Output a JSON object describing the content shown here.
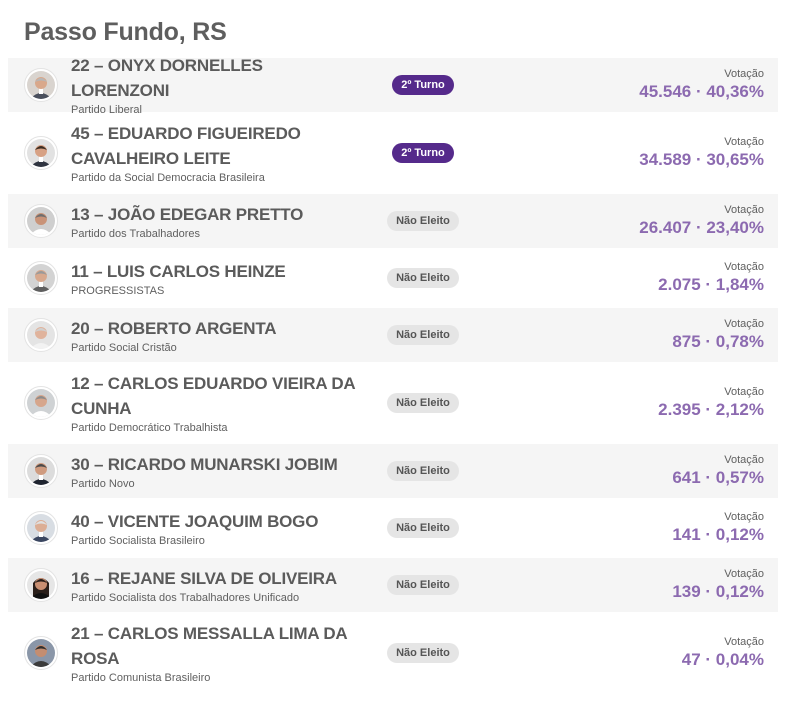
{
  "page": {
    "title": "Passo Fundo, RS"
  },
  "colors": {
    "turno_badge": "#552a8b",
    "votes": "#8c6ab0",
    "nao_eleito_badge": "#e5e5e5"
  },
  "candidates": [
    {
      "name": "22 – ONYX DORNELLES LORENZONI",
      "party": "Partido Liberal",
      "status": "2º Turno",
      "votes_label": "Votação",
      "votes": "45.546 · 40,36%",
      "avatar_icon": "person-silver-hair-icon"
    },
    {
      "name": "45 – EDUARDO FIGUEIREDO CAVALHEIRO LEITE",
      "party": "Partido da Social Democracia Brasileira",
      "status": "2º Turno",
      "votes_label": "Votação",
      "votes": "34.589 · 30,65%",
      "avatar_icon": "person-dark-hair-icon"
    },
    {
      "name": "13 – JOÃO EDEGAR PRETTO",
      "party": "Partido dos Trabalhadores",
      "status": "Não Eleito",
      "votes_label": "Votação",
      "votes": "26.407 · 23,40%",
      "avatar_icon": "person-grey-hair-icon"
    },
    {
      "name": "11 – LUIS CARLOS HEINZE",
      "party": "PROGRESSISTAS",
      "status": "Não Eleito",
      "votes_label": "Votação",
      "votes": "2.075 · 1,84%",
      "avatar_icon": "person-grey-hair-icon"
    },
    {
      "name": "20 – ROBERTO ARGENTA",
      "party": "Partido Social Cristão",
      "status": "Não Eleito",
      "votes_label": "Votação",
      "votes": "875 · 0,78%",
      "avatar_icon": "person-white-hair-icon"
    },
    {
      "name": "12 – CARLOS EDUARDO VIEIRA DA CUNHA",
      "party": "Partido Democrático Trabalhista",
      "status": "Não Eleito",
      "votes_label": "Votação",
      "votes": "2.395 · 2,12%",
      "avatar_icon": "person-grey-hair-icon"
    },
    {
      "name": "30 – RICARDO MUNARSKI JOBIM",
      "party": "Partido Novo",
      "status": "Não Eleito",
      "votes_label": "Votação",
      "votes": "641 · 0,57%",
      "avatar_icon": "person-dark-suit-icon"
    },
    {
      "name": "40 – VICENTE JOAQUIM BOGO",
      "party": "Partido Socialista Brasileiro",
      "status": "Não Eleito",
      "votes_label": "Votação",
      "votes": "141 · 0,12%",
      "avatar_icon": "person-white-hair-icon"
    },
    {
      "name": "16 – REJANE SILVA DE OLIVEIRA",
      "party": "Partido Socialista dos Trabalhadores Unificado",
      "status": "Não Eleito",
      "votes_label": "Votação",
      "votes": "139 · 0,12%",
      "avatar_icon": "person-long-dark-hair-icon"
    },
    {
      "name": "21 – CARLOS MESSALLA LIMA DA ROSA",
      "party": "Partido Comunista Brasileiro",
      "status": "Não Eleito",
      "votes_label": "Votação",
      "votes": "47 · 0,04%",
      "avatar_icon": "person-dark-hair-icon"
    }
  ]
}
